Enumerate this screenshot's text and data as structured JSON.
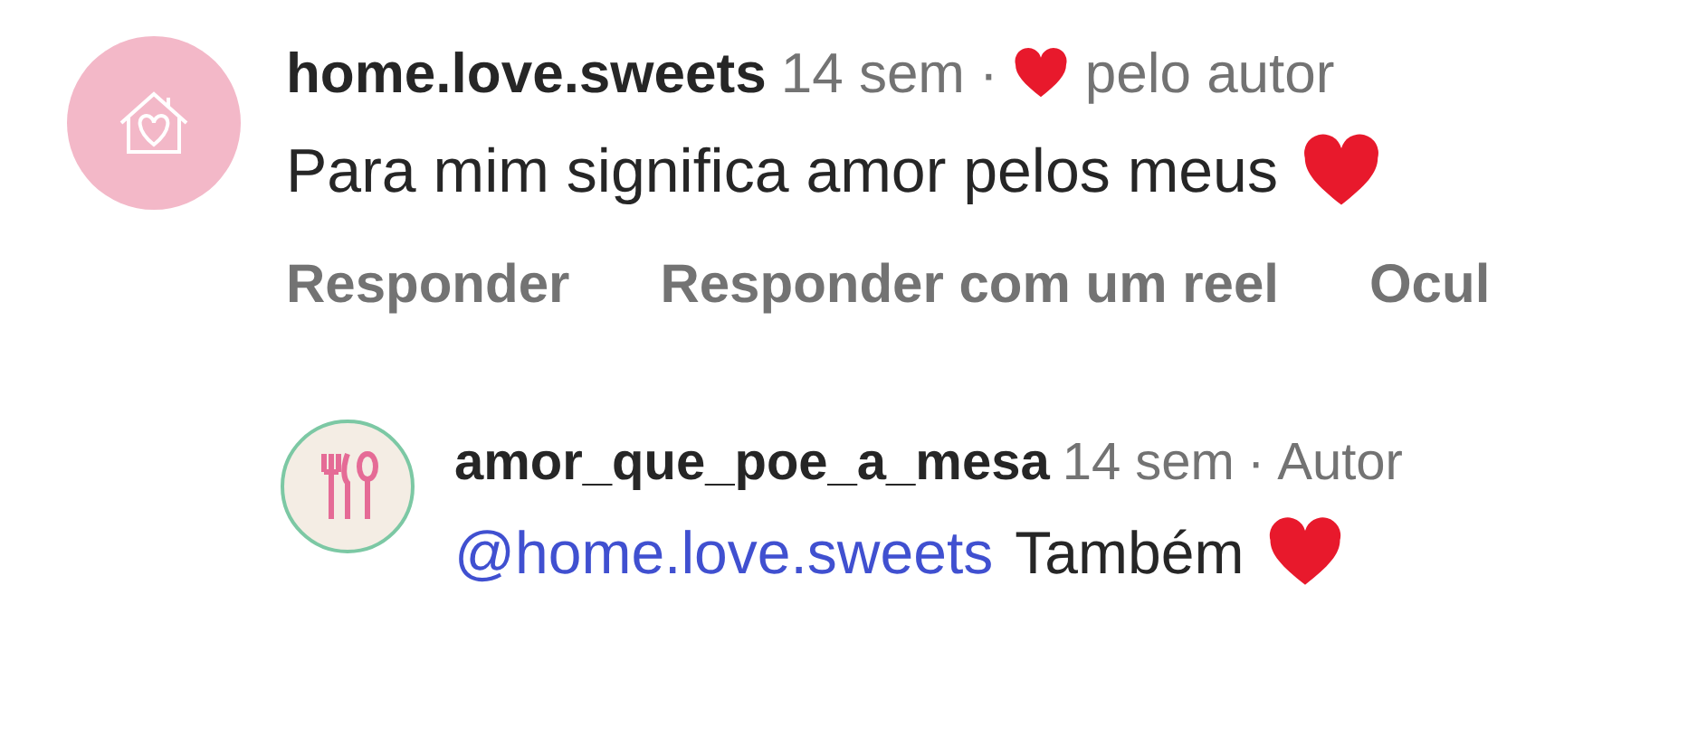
{
  "comments": [
    {
      "username": "home.love.sweets",
      "time": "14 sem",
      "separator": "·",
      "liked_by_author": true,
      "author_like_label": "pelo autor",
      "text": "Para mim significa amor pelos meus",
      "text_heart": true,
      "actions": [
        "Responder",
        "Responder com um reel",
        "Ocul"
      ],
      "replies": [
        {
          "username": "amor_que_poe_a_mesa",
          "time": "14 sem",
          "separator": "·",
          "badge": "Autor",
          "mention": "@home.love.sweets",
          "text": "Também",
          "text_heart": true
        }
      ]
    }
  ]
}
